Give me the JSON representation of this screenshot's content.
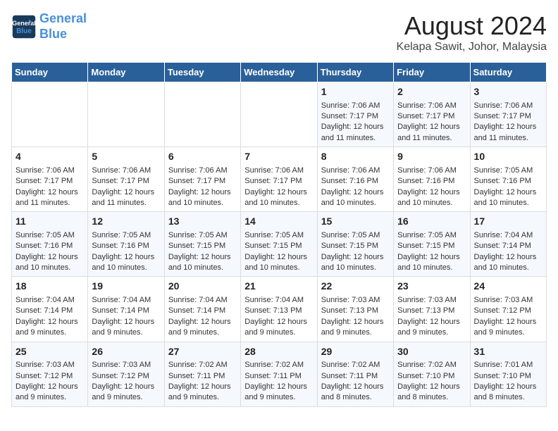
{
  "header": {
    "logo_line1": "General",
    "logo_line2": "Blue",
    "main_title": "August 2024",
    "subtitle": "Kelapa Sawit, Johor, Malaysia"
  },
  "weekdays": [
    "Sunday",
    "Monday",
    "Tuesday",
    "Wednesday",
    "Thursday",
    "Friday",
    "Saturday"
  ],
  "weeks": [
    [
      {
        "day": "",
        "info": ""
      },
      {
        "day": "",
        "info": ""
      },
      {
        "day": "",
        "info": ""
      },
      {
        "day": "",
        "info": ""
      },
      {
        "day": "1",
        "info": "Sunrise: 7:06 AM\nSunset: 7:17 PM\nDaylight: 12 hours\nand 11 minutes."
      },
      {
        "day": "2",
        "info": "Sunrise: 7:06 AM\nSunset: 7:17 PM\nDaylight: 12 hours\nand 11 minutes."
      },
      {
        "day": "3",
        "info": "Sunrise: 7:06 AM\nSunset: 7:17 PM\nDaylight: 12 hours\nand 11 minutes."
      }
    ],
    [
      {
        "day": "4",
        "info": "Sunrise: 7:06 AM\nSunset: 7:17 PM\nDaylight: 12 hours\nand 11 minutes."
      },
      {
        "day": "5",
        "info": "Sunrise: 7:06 AM\nSunset: 7:17 PM\nDaylight: 12 hours\nand 11 minutes."
      },
      {
        "day": "6",
        "info": "Sunrise: 7:06 AM\nSunset: 7:17 PM\nDaylight: 12 hours\nand 10 minutes."
      },
      {
        "day": "7",
        "info": "Sunrise: 7:06 AM\nSunset: 7:17 PM\nDaylight: 12 hours\nand 10 minutes."
      },
      {
        "day": "8",
        "info": "Sunrise: 7:06 AM\nSunset: 7:16 PM\nDaylight: 12 hours\nand 10 minutes."
      },
      {
        "day": "9",
        "info": "Sunrise: 7:06 AM\nSunset: 7:16 PM\nDaylight: 12 hours\nand 10 minutes."
      },
      {
        "day": "10",
        "info": "Sunrise: 7:05 AM\nSunset: 7:16 PM\nDaylight: 12 hours\nand 10 minutes."
      }
    ],
    [
      {
        "day": "11",
        "info": "Sunrise: 7:05 AM\nSunset: 7:16 PM\nDaylight: 12 hours\nand 10 minutes."
      },
      {
        "day": "12",
        "info": "Sunrise: 7:05 AM\nSunset: 7:16 PM\nDaylight: 12 hours\nand 10 minutes."
      },
      {
        "day": "13",
        "info": "Sunrise: 7:05 AM\nSunset: 7:15 PM\nDaylight: 12 hours\nand 10 minutes."
      },
      {
        "day": "14",
        "info": "Sunrise: 7:05 AM\nSunset: 7:15 PM\nDaylight: 12 hours\nand 10 minutes."
      },
      {
        "day": "15",
        "info": "Sunrise: 7:05 AM\nSunset: 7:15 PM\nDaylight: 12 hours\nand 10 minutes."
      },
      {
        "day": "16",
        "info": "Sunrise: 7:05 AM\nSunset: 7:15 PM\nDaylight: 12 hours\nand 10 minutes."
      },
      {
        "day": "17",
        "info": "Sunrise: 7:04 AM\nSunset: 7:14 PM\nDaylight: 12 hours\nand 10 minutes."
      }
    ],
    [
      {
        "day": "18",
        "info": "Sunrise: 7:04 AM\nSunset: 7:14 PM\nDaylight: 12 hours\nand 9 minutes."
      },
      {
        "day": "19",
        "info": "Sunrise: 7:04 AM\nSunset: 7:14 PM\nDaylight: 12 hours\nand 9 minutes."
      },
      {
        "day": "20",
        "info": "Sunrise: 7:04 AM\nSunset: 7:14 PM\nDaylight: 12 hours\nand 9 minutes."
      },
      {
        "day": "21",
        "info": "Sunrise: 7:04 AM\nSunset: 7:13 PM\nDaylight: 12 hours\nand 9 minutes."
      },
      {
        "day": "22",
        "info": "Sunrise: 7:03 AM\nSunset: 7:13 PM\nDaylight: 12 hours\nand 9 minutes."
      },
      {
        "day": "23",
        "info": "Sunrise: 7:03 AM\nSunset: 7:13 PM\nDaylight: 12 hours\nand 9 minutes."
      },
      {
        "day": "24",
        "info": "Sunrise: 7:03 AM\nSunset: 7:12 PM\nDaylight: 12 hours\nand 9 minutes."
      }
    ],
    [
      {
        "day": "25",
        "info": "Sunrise: 7:03 AM\nSunset: 7:12 PM\nDaylight: 12 hours\nand 9 minutes."
      },
      {
        "day": "26",
        "info": "Sunrise: 7:03 AM\nSunset: 7:12 PM\nDaylight: 12 hours\nand 9 minutes."
      },
      {
        "day": "27",
        "info": "Sunrise: 7:02 AM\nSunset: 7:11 PM\nDaylight: 12 hours\nand 9 minutes."
      },
      {
        "day": "28",
        "info": "Sunrise: 7:02 AM\nSunset: 7:11 PM\nDaylight: 12 hours\nand 9 minutes."
      },
      {
        "day": "29",
        "info": "Sunrise: 7:02 AM\nSunset: 7:11 PM\nDaylight: 12 hours\nand 8 minutes."
      },
      {
        "day": "30",
        "info": "Sunrise: 7:02 AM\nSunset: 7:10 PM\nDaylight: 12 hours\nand 8 minutes."
      },
      {
        "day": "31",
        "info": "Sunrise: 7:01 AM\nSunset: 7:10 PM\nDaylight: 12 hours\nand 8 minutes."
      }
    ]
  ]
}
